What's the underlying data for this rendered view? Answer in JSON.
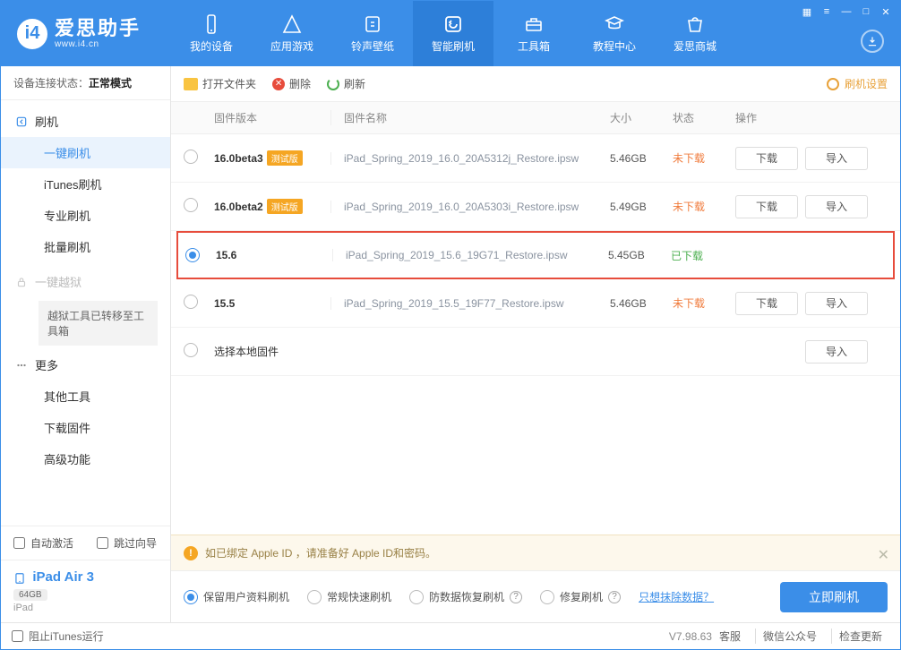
{
  "header": {
    "appName": "爱思助手",
    "url": "www.i4.cn",
    "tabs": [
      {
        "label": "我的设备"
      },
      {
        "label": "应用游戏"
      },
      {
        "label": "铃声壁纸"
      },
      {
        "label": "智能刷机"
      },
      {
        "label": "工具箱"
      },
      {
        "label": "教程中心"
      },
      {
        "label": "爱思商城"
      }
    ]
  },
  "sidebar": {
    "statusLabel": "设备连接状态：",
    "statusValue": "正常模式",
    "flashGroup": "刷机",
    "items": [
      "一键刷机",
      "iTunes刷机",
      "专业刷机",
      "批量刷机"
    ],
    "jailbreak": "一键越狱",
    "jailbreakNote": "越狱工具已转移至工具箱",
    "moreGroup": "更多",
    "more": [
      "其他工具",
      "下载固件",
      "高级功能"
    ],
    "autoActivate": "自动激活",
    "skipWizard": "跳过向导",
    "deviceName": "iPad Air 3",
    "deviceCap": "64GB",
    "deviceType": "iPad"
  },
  "toolbar": {
    "openFolder": "打开文件夹",
    "delete": "删除",
    "refresh": "刷新",
    "settings": "刷机设置"
  },
  "table": {
    "headers": {
      "version": "固件版本",
      "name": "固件名称",
      "size": "大小",
      "status": "状态",
      "action": "操作"
    },
    "betaTag": "测试版",
    "downloadBtn": "下载",
    "importBtn": "导入",
    "localFirmware": "选择本地固件",
    "status": {
      "pending": "未下载",
      "done": "已下载"
    },
    "rows": [
      {
        "version": "16.0beta3",
        "beta": true,
        "name": "iPad_Spring_2019_16.0_20A5312j_Restore.ipsw",
        "size": "5.46GB",
        "status": "pending",
        "selected": false,
        "showActions": true
      },
      {
        "version": "16.0beta2",
        "beta": true,
        "name": "iPad_Spring_2019_16.0_20A5303i_Restore.ipsw",
        "size": "5.49GB",
        "status": "pending",
        "selected": false,
        "showActions": true
      },
      {
        "version": "15.6",
        "beta": false,
        "name": "iPad_Spring_2019_15.6_19G71_Restore.ipsw",
        "size": "5.45GB",
        "status": "done",
        "selected": true,
        "showActions": false,
        "highlight": true
      },
      {
        "version": "15.5",
        "beta": false,
        "name": "iPad_Spring_2019_15.5_19F77_Restore.ipsw",
        "size": "5.46GB",
        "status": "pending",
        "selected": false,
        "showActions": true
      }
    ]
  },
  "notice": "如已绑定 Apple ID ，请准备好 Apple ID和密码。",
  "options": {
    "o1": "保留用户资料刷机",
    "o2": "常规快速刷机",
    "o3": "防数据恢复刷机",
    "o4": "修复刷机",
    "onlyErase": "只想抹除数据？",
    "flashNow": "立即刷机"
  },
  "footer": {
    "blockItunes": "阻止iTunes运行",
    "version": "V7.98.63",
    "links": [
      "客服",
      "微信公众号",
      "检查更新"
    ]
  }
}
